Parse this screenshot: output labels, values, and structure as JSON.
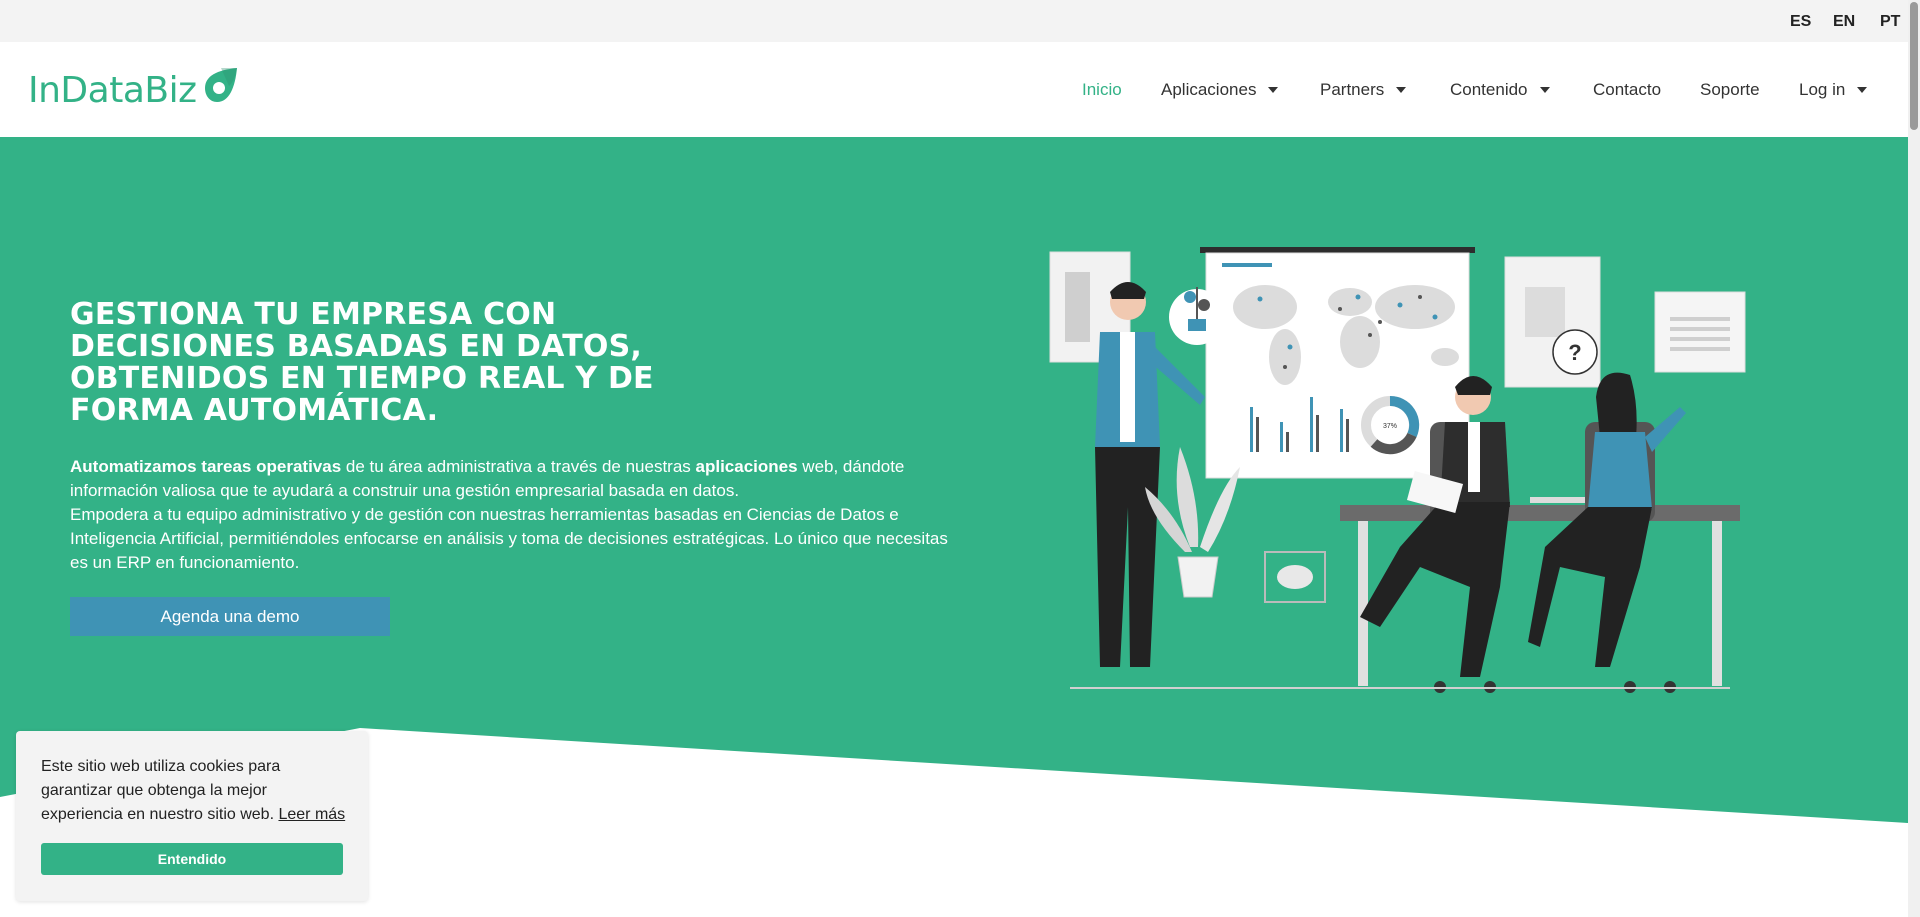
{
  "languages": [
    "ES",
    "EN",
    "PT"
  ],
  "brand": {
    "name": "InDataBiz",
    "color": "#33b287"
  },
  "nav": {
    "items": [
      {
        "label": "Inicio",
        "active": true,
        "dropdown": false
      },
      {
        "label": "Aplicaciones",
        "active": false,
        "dropdown": true
      },
      {
        "label": "Partners",
        "active": false,
        "dropdown": true
      },
      {
        "label": "Contenido",
        "active": false,
        "dropdown": true
      },
      {
        "label": "Contacto",
        "active": false,
        "dropdown": false
      },
      {
        "label": "Soporte",
        "active": false,
        "dropdown": false
      },
      {
        "label": "Log in",
        "active": false,
        "dropdown": true
      }
    ]
  },
  "hero": {
    "title_lines": [
      "GESTIONA TU EMPRESA CON",
      "DECISIONES BASADAS EN DATOS,",
      "OBTENIDOS EN TIEMPO REAL Y DE",
      "FORMA AUTOMÁTICA."
    ],
    "paragraph1": {
      "bold1": "Automatizamos tareas operativas",
      "text1": " de tu área administrativa a través de nuestras ",
      "bold2": "aplicaciones",
      "text2": " web, dándote información valiosa que te ayudará a construir una gestión empresarial basada en datos."
    },
    "paragraph2": "Empodera a tu equipo administrativo y de gestión con nuestras herramientas basadas en Ciencias de Datos e Inteligencia Artificial, permitiéndoles enfocarse en análisis y toma de decisiones estratégicas. Lo único que necesitas es un ERP en funcionamiento.",
    "cta_label": "Agenda una demo",
    "donut_label": "37%",
    "colors": {
      "background": "#33b287",
      "cta": "#3f93b5"
    }
  },
  "cookie": {
    "text": "Este sitio web utiliza cookies para garantizar que obtenga la mejor experiencia en nuestro sitio web. ",
    "link_label": "Leer más",
    "button_label": "Entendido"
  }
}
